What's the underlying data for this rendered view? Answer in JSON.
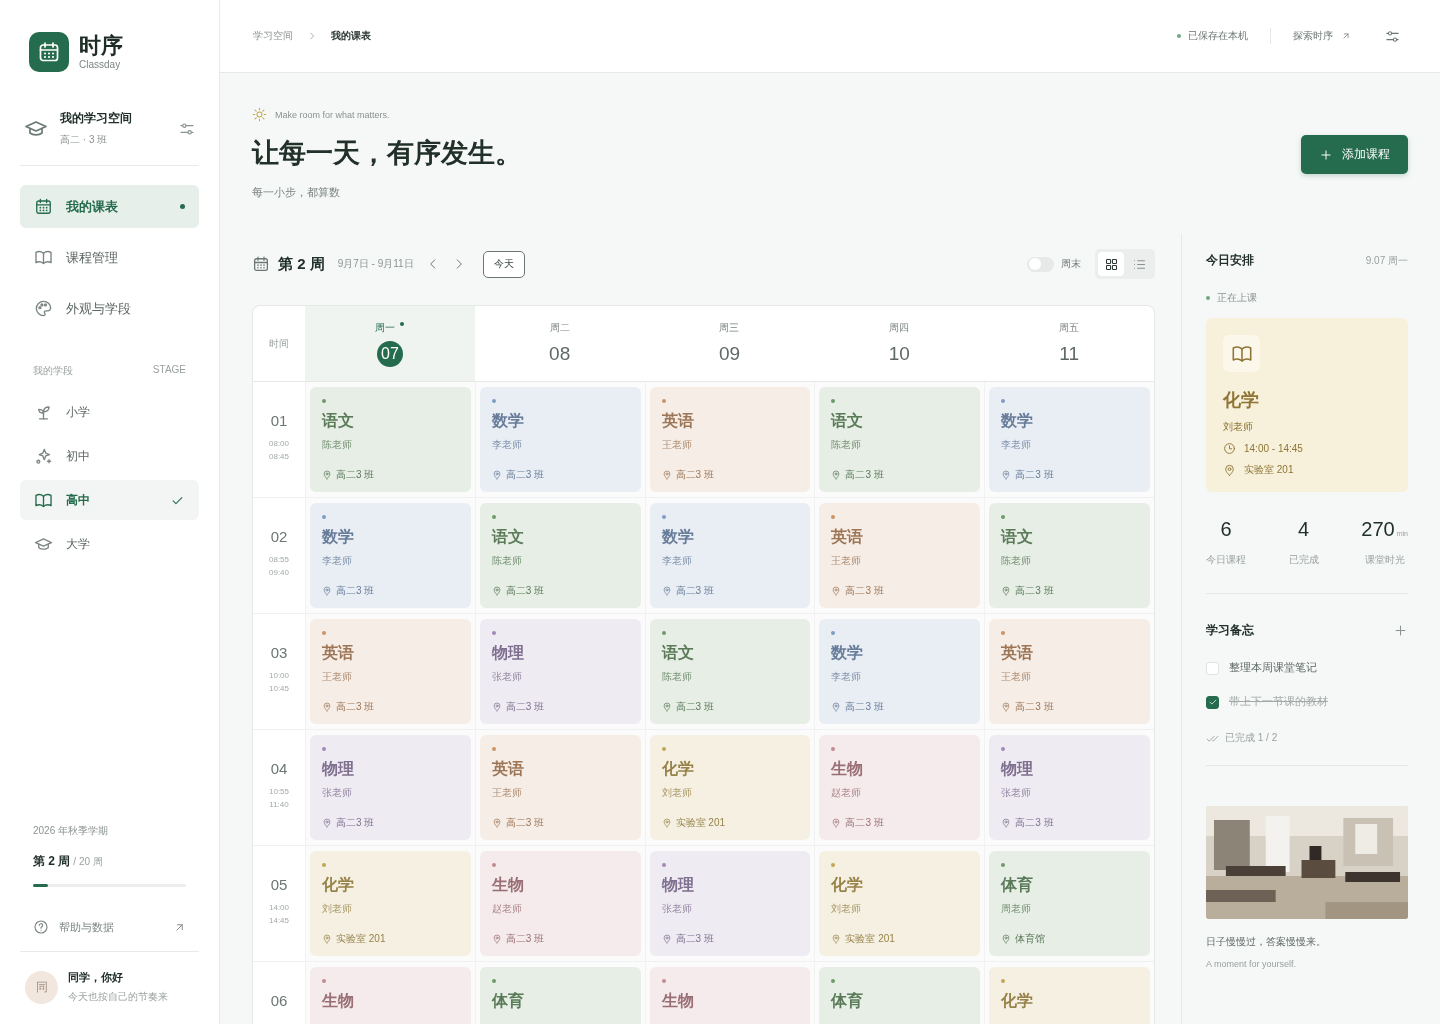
{
  "sidebar": {
    "logo": {
      "title": "时序",
      "subtitle": "Classday"
    },
    "workspace": {
      "name": "我的学习空间",
      "class": "高二 · 3 班"
    },
    "nav": [
      {
        "label": "我的课表",
        "selected": true
      },
      {
        "label": "课程管理",
        "selected": false
      },
      {
        "label": "外观与学段",
        "selected": false
      }
    ],
    "stage_section": {
      "title": "我的学段",
      "hint": "STAGE"
    },
    "stages": [
      {
        "label": "小学",
        "selected": false
      },
      {
        "label": "初中",
        "selected": false
      },
      {
        "label": "高中",
        "selected": true
      },
      {
        "label": "大学",
        "selected": false
      }
    ],
    "semester": {
      "title": "2026 年秋季学期",
      "week": "第 2 周",
      "total": "/ 20 周",
      "level": 0.1
    },
    "help": {
      "label": "帮助与数据"
    },
    "user": {
      "avatar": "同",
      "greeting": "同学，你好",
      "note": "今天也按自己的节奏来"
    }
  },
  "header": {
    "breadcrumb": [
      "学习空间",
      "我的课表"
    ],
    "status": "已保存在本机",
    "explore": "探索时序"
  },
  "hero": {
    "tagline": "Make room for what matters.",
    "title": "让每一天，有序发生。",
    "subtitle": "每一小步，都算数",
    "add_button": "添加课程"
  },
  "week": {
    "title": "第 2 周",
    "range": "9月7日 - 9月11日",
    "today_button": "今天",
    "weekend": {
      "label": "周末",
      "on": false
    },
    "views": [
      {
        "kind": "grid",
        "selected": true
      },
      {
        "kind": "list",
        "selected": false
      }
    ]
  },
  "timetable": {
    "time_header": "时间",
    "days": [
      {
        "weekday": "周一",
        "date": "07",
        "selected": true
      },
      {
        "weekday": "周二",
        "date": "08",
        "selected": false
      },
      {
        "weekday": "周三",
        "date": "09",
        "selected": false
      },
      {
        "weekday": "周四",
        "date": "10",
        "selected": false
      },
      {
        "weekday": "周五",
        "date": "11",
        "selected": false
      }
    ],
    "periods": [
      {
        "number": "01",
        "start": "08:00",
        "end": "08:45",
        "classes": [
          {
            "subject": "语文",
            "teacher": "陈老师",
            "location": "高二3 班",
            "color": "#6e9a6a"
          },
          {
            "subject": "数学",
            "teacher": "李老师",
            "location": "高二3 班",
            "color": "#7f9cc4"
          },
          {
            "subject": "英语",
            "teacher": "王老师",
            "location": "高二3 班",
            "color": "#c99469"
          },
          {
            "subject": "语文",
            "teacher": "陈老师",
            "location": "高二3 班",
            "color": "#6e9a6a"
          },
          {
            "subject": "数学",
            "teacher": "李老师",
            "location": "高二3 班",
            "color": "#7f9cc4"
          }
        ]
      },
      {
        "number": "02",
        "start": "08:55",
        "end": "09:40",
        "classes": [
          {
            "subject": "数学",
            "teacher": "李老师",
            "location": "高二3 班",
            "color": "#7f9cc4"
          },
          {
            "subject": "语文",
            "teacher": "陈老师",
            "location": "高二3 班",
            "color": "#6e9a6a"
          },
          {
            "subject": "数学",
            "teacher": "李老师",
            "location": "高二3 班",
            "color": "#7f9cc4"
          },
          {
            "subject": "英语",
            "teacher": "王老师",
            "location": "高二3 班",
            "color": "#c99469"
          },
          {
            "subject": "语文",
            "teacher": "陈老师",
            "location": "高二3 班",
            "color": "#6e9a6a"
          }
        ]
      },
      {
        "number": "03",
        "start": "10:00",
        "end": "10:45",
        "classes": [
          {
            "subject": "英语",
            "teacher": "王老师",
            "location": "高二3 班",
            "color": "#c99469"
          },
          {
            "subject": "物理",
            "teacher": "张老师",
            "location": "高二3 班",
            "color": "#a08bb8"
          },
          {
            "subject": "语文",
            "teacher": "陈老师",
            "location": "高二3 班",
            "color": "#6e9a6a"
          },
          {
            "subject": "数学",
            "teacher": "李老师",
            "location": "高二3 班",
            "color": "#7f9cc4"
          },
          {
            "subject": "英语",
            "teacher": "王老师",
            "location": "高二3 班",
            "color": "#c99469"
          }
        ]
      },
      {
        "number": "04",
        "start": "10:55",
        "end": "11:40",
        "classes": [
          {
            "subject": "物理",
            "teacher": "张老师",
            "location": "高二3 班",
            "color": "#a08bb8"
          },
          {
            "subject": "英语",
            "teacher": "王老师",
            "location": "高二3 班",
            "color": "#c99469"
          },
          {
            "subject": "化学",
            "teacher": "刘老师",
            "location": "实验室 201",
            "color": "#c2a657"
          },
          {
            "subject": "生物",
            "teacher": "赵老师",
            "location": "高二3 班",
            "color": "#c48a92"
          },
          {
            "subject": "物理",
            "teacher": "张老师",
            "location": "高二3 班",
            "color": "#a08bb8"
          }
        ]
      },
      {
        "number": "05",
        "start": "14:00",
        "end": "14:45",
        "classes": [
          {
            "subject": "化学",
            "teacher": "刘老师",
            "location": "实验室 201",
            "color": "#c2a657"
          },
          {
            "subject": "生物",
            "teacher": "赵老师",
            "location": "高二3 班",
            "color": "#c48a92"
          },
          {
            "subject": "物理",
            "teacher": "张老师",
            "location": "高二3 班",
            "color": "#a08bb8"
          },
          {
            "subject": "化学",
            "teacher": "刘老师",
            "location": "实验室 201",
            "color": "#c2a657"
          },
          {
            "subject": "体育",
            "teacher": "周老师",
            "location": "体育馆",
            "color": "#6e9a6a"
          }
        ]
      },
      {
        "number": "06",
        "classes": [
          {
            "subject": "生物",
            "color": "#c48a92"
          },
          {
            "subject": "体育",
            "color": "#6e9a6a"
          },
          {
            "subject": "生物",
            "color": "#c48a92"
          },
          {
            "subject": "体育",
            "color": "#6e9a6a"
          },
          {
            "subject": "化学",
            "color": "#c2a657"
          }
        ]
      }
    ]
  },
  "today": {
    "title": "今日安排",
    "date": "9.07 周一",
    "status": "正在上课",
    "current": {
      "subject": "化学",
      "teacher": "刘老师",
      "time": "14:00 - 14:45",
      "location": "实验室 201"
    },
    "stats": [
      {
        "value": "6",
        "label": "今日课程"
      },
      {
        "value": "4",
        "label": "已完成"
      },
      {
        "value": "270",
        "unit": "min",
        "label": "课堂时光"
      }
    ],
    "memo": {
      "title": "学习备忘",
      "todos": [
        {
          "text": "整理本周课堂笔记",
          "checked": false
        },
        {
          "text": "带上下一节课的教材",
          "checked": true
        }
      ],
      "done": "已完成 1 / 2"
    },
    "quote": "日子慢慢过，答案慢慢来。",
    "quote_en": "A moment for yourself."
  }
}
